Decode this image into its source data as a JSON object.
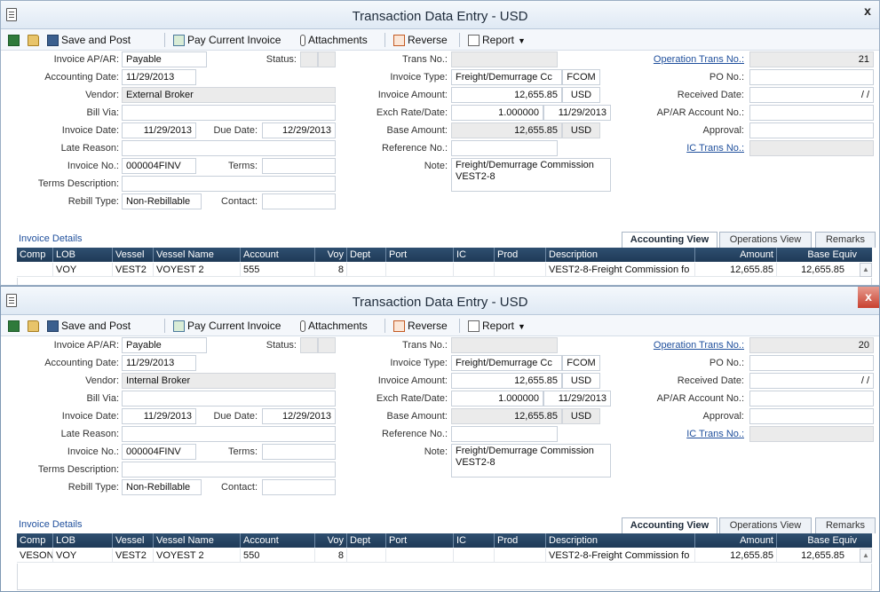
{
  "toolbar": {
    "save_post": "Save and Post",
    "pay_invoice": "Pay Current Invoice",
    "attachments": "Attachments",
    "reverse": "Reverse",
    "report": "Report"
  },
  "labels": {
    "invoice_ap_ar": "Invoice AP/AR:",
    "accounting_date": "Accounting Date:",
    "vendor": "Vendor:",
    "bill_via": "Bill Via:",
    "invoice_date": "Invoice Date:",
    "due_date": "Due Date:",
    "late_reason": "Late Reason:",
    "invoice_no": "Invoice No.:",
    "terms": "Terms:",
    "terms_description": "Terms Description:",
    "rebill_type": "Rebill Type:",
    "contact": "Contact:",
    "status": "Status:",
    "trans_no": "Trans No.:",
    "invoice_type": "Invoice Type:",
    "invoice_amount": "Invoice Amount:",
    "exch_rate_date": "Exch Rate/Date:",
    "base_amount": "Base Amount:",
    "reference_no": "Reference No.:",
    "note": "Note:",
    "operation_trans_no": "Operation Trans No.:",
    "po_no": "PO No.:",
    "received_date": "Received Date:",
    "ap_ar_account_no": "AP/AR Account No.:",
    "approval": "Approval:",
    "ic_trans_no": "IC Trans No.:",
    "invoice_details": "Invoice Details"
  },
  "tabs": [
    "Accounting View",
    "Operations View",
    "Remarks"
  ],
  "columns": [
    "Comp",
    "LOB",
    "Vessel",
    "Vessel Name",
    "Account",
    "Voy",
    "Dept",
    "Port",
    "IC",
    "Prod",
    "Description",
    "Amount",
    "Base Equiv"
  ],
  "windows": [
    {
      "title": "Transaction Data Entry - USD",
      "close_glyph": "x",
      "fields": {
        "invoice_ap_ar": "Payable",
        "accounting_date": "11/29/2013",
        "vendor": "External Broker",
        "bill_via": "",
        "invoice_date": "11/29/2013",
        "due_date": "12/29/2013",
        "late_reason": "",
        "invoice_no": "000004FINV",
        "terms": "",
        "terms_description": "",
        "rebill_type": "Non-Rebillable",
        "contact": "",
        "trans_no": "",
        "invoice_type": "Freight/Demurrage Cc",
        "invoice_type_code": "FCOM",
        "invoice_amount": "12,655.85",
        "invoice_currency": "USD",
        "exch_rate": "1.000000",
        "exch_date": "11/29/2013",
        "base_amount": "12,655.85",
        "base_currency": "USD",
        "reference_no": "",
        "note": "Freight/Demurrage Commission VEST2-8",
        "operation_trans_no": "21",
        "po_no": "",
        "received_date": "/ /",
        "ap_ar_account_no": "",
        "approval": "",
        "ic_trans_no": ""
      },
      "rows": [
        {
          "comp": "",
          "lob": "VOY",
          "vessel": "VEST2",
          "vessel_name": "VOYEST 2",
          "account": "555",
          "voy": "8",
          "dept": "",
          "port": "",
          "ic": "",
          "prod": "",
          "description": "VEST2-8-Freight Commission fo",
          "amount": "12,655.85",
          "base_equiv": "12,655.85"
        }
      ]
    },
    {
      "title": "Transaction Data Entry - USD",
      "close_glyph": "x",
      "fields": {
        "invoice_ap_ar": "Payable",
        "accounting_date": "11/29/2013",
        "vendor": "Internal Broker",
        "bill_via": "",
        "invoice_date": "11/29/2013",
        "due_date": "12/29/2013",
        "late_reason": "",
        "invoice_no": "000004FINV",
        "terms": "",
        "terms_description": "",
        "rebill_type": "Non-Rebillable",
        "contact": "",
        "trans_no": "",
        "invoice_type": "Freight/Demurrage Cc",
        "invoice_type_code": "FCOM",
        "invoice_amount": "12,655.85",
        "invoice_currency": "USD",
        "exch_rate": "1.000000",
        "exch_date": "11/29/2013",
        "base_amount": "12,655.85",
        "base_currency": "USD",
        "reference_no": "",
        "note": "Freight/Demurrage Commission VEST2-8",
        "operation_trans_no": "20",
        "po_no": "",
        "received_date": "/ /",
        "ap_ar_account_no": "",
        "approval": "",
        "ic_trans_no": ""
      },
      "rows": [
        {
          "comp": "VESON",
          "lob": "VOY",
          "vessel": "VEST2",
          "vessel_name": "VOYEST 2",
          "account": "550",
          "voy": "8",
          "dept": "",
          "port": "",
          "ic": "",
          "prod": "",
          "description": "VEST2-8-Freight Commission fo",
          "amount": "12,655.85",
          "base_equiv": "12,655.85"
        }
      ]
    }
  ]
}
